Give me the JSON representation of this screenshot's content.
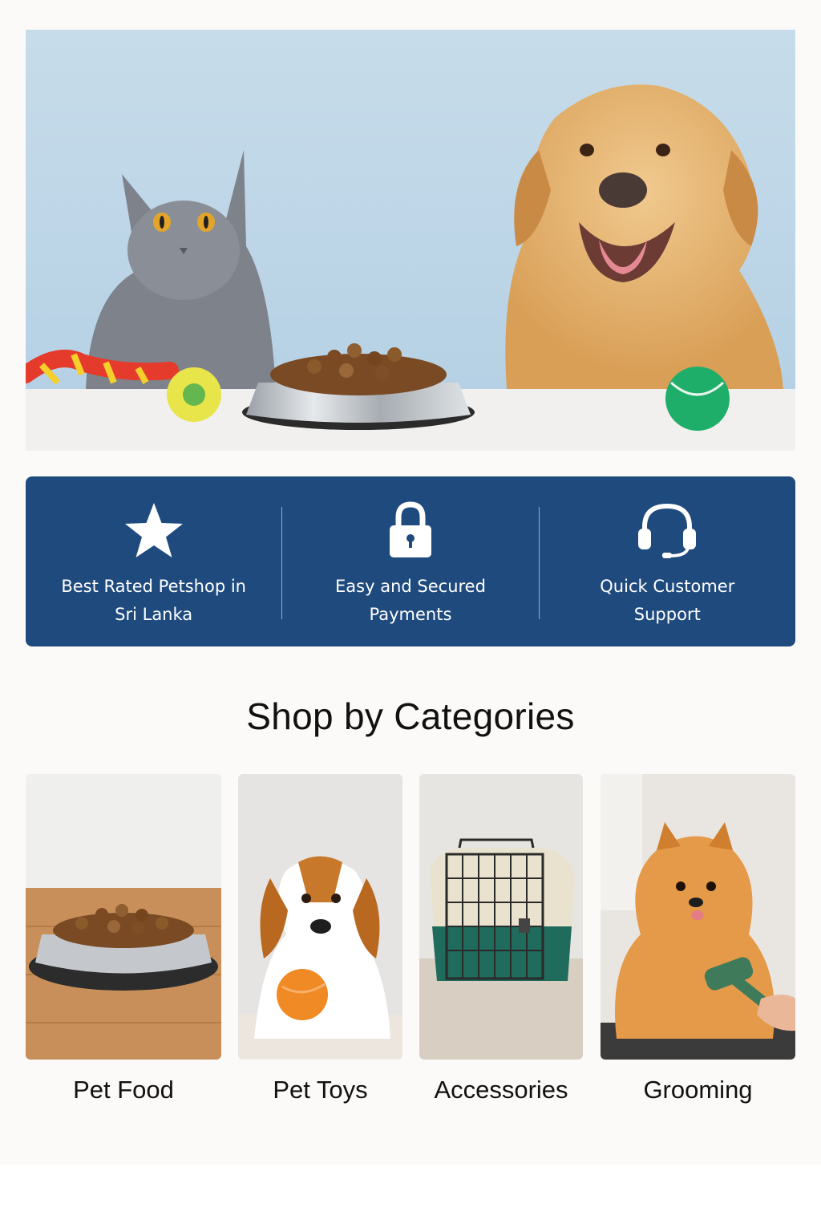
{
  "features": [
    {
      "icon": "star-icon",
      "label": "Best Rated Petshop in Sri Lanka"
    },
    {
      "icon": "lock-icon",
      "label": "Easy and Secured Payments"
    },
    {
      "icon": "headset-icon",
      "label": "Quick Customer Support"
    }
  ],
  "section_title": "Shop by Categories",
  "categories": [
    {
      "label": "Pet Food"
    },
    {
      "label": "Pet Toys"
    },
    {
      "label": "Accessories"
    },
    {
      "label": "Grooming"
    }
  ],
  "colors": {
    "feature_bar": "#1f4a7e",
    "page_background": "#fbfaf8"
  }
}
